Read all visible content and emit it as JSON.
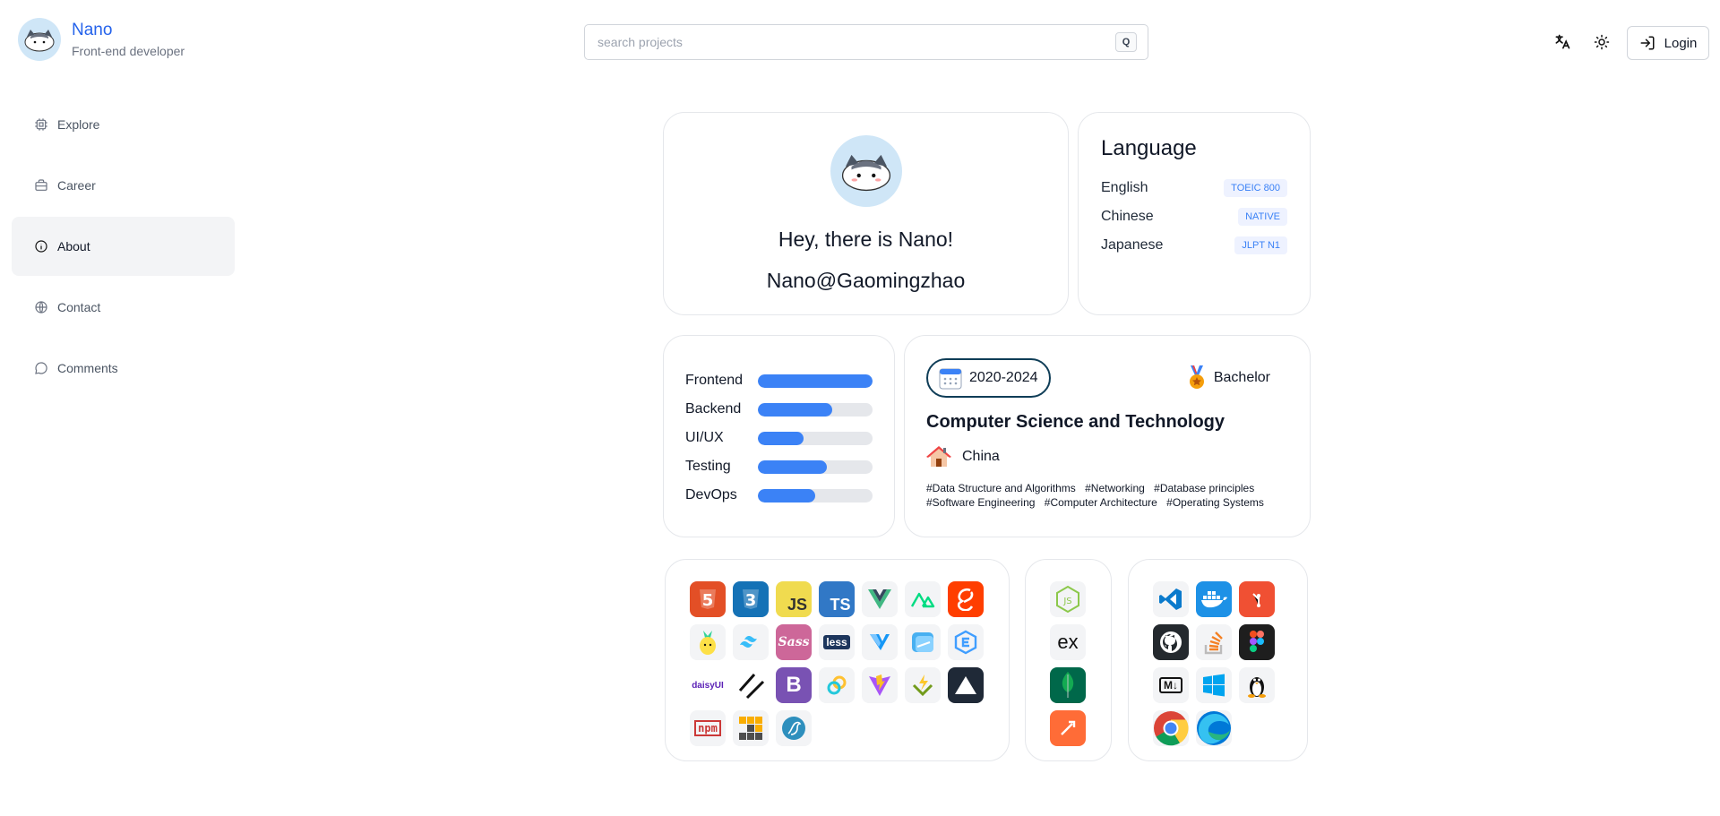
{
  "brand": {
    "name": "Nano",
    "subtitle": "Front-end developer"
  },
  "search": {
    "placeholder": "search projects",
    "key": "Q"
  },
  "header": {
    "login_label": "Login"
  },
  "nav": [
    {
      "label": "Explore",
      "icon": "cpu-icon",
      "active": false
    },
    {
      "label": "Career",
      "icon": "briefcase-icon",
      "active": false
    },
    {
      "label": "About",
      "icon": "info-icon",
      "active": true
    },
    {
      "label": "Contact",
      "icon": "globe-icon",
      "active": false
    },
    {
      "label": "Comments",
      "icon": "chat-icon",
      "active": false
    }
  ],
  "profile": {
    "greeting": "Hey, there is Nano!",
    "handle": "Nano@Gaomingzhao"
  },
  "language": {
    "title": "Language",
    "items": [
      {
        "name": "English",
        "level": "TOEIC 800"
      },
      {
        "name": "Chinese",
        "level": "NATIVE"
      },
      {
        "name": "Japanese",
        "level": "JLPT N1"
      }
    ]
  },
  "skills": [
    {
      "name": "Frontend",
      "level": 1.0
    },
    {
      "name": "Backend",
      "level": 0.65
    },
    {
      "name": "UI/UX",
      "level": 0.4
    },
    {
      "name": "Testing",
      "level": 0.6
    },
    {
      "name": "DevOps",
      "level": 0.5
    }
  ],
  "education": {
    "years": "2020-2024",
    "degree": "Bachelor",
    "major": "Computer Science and Technology",
    "location": "China",
    "tags": [
      "#Data Structure and Algorithms",
      "#Networking",
      "#Database principles",
      "#Software Engineering",
      "#Computer Architecture",
      "#Operating Systems"
    ]
  },
  "tech": {
    "frontend": [
      "html5-icon",
      "css3-icon",
      "javascript-icon",
      "typescript-icon",
      "vue-icon",
      "nuxt-icon",
      "svelte-icon",
      "pinia-icon",
      "tailwind-icon",
      "sass-icon",
      "less-icon",
      "vuetify-icon",
      "windicss-icon",
      "element-plus-icon",
      "daisyui-icon",
      "shadcn-icon",
      "bootstrap-icon",
      "tauri-icon",
      "vite-icon",
      "vitest-icon",
      "vercel-icon",
      "npm-icon",
      "pnpm-icon",
      "mariadb-icon"
    ],
    "backend": [
      "nodejs-icon",
      "express-icon",
      "mongodb-icon",
      "postman-icon"
    ],
    "tools": [
      "vscode-icon",
      "docker-icon",
      "git-icon",
      "github-icon",
      "stackoverflow-icon",
      "figma-icon",
      "markdown-icon",
      "windows-icon",
      "linux-icon",
      "chrome-icon",
      "edge-icon"
    ]
  },
  "tile_labels": {
    "js": "JS",
    "ts": "TS",
    "less": "less",
    "daisy": "daisyUI",
    "npm": "npm",
    "md": "M↓",
    "ex": "ex"
  },
  "colors": {
    "accent": "#2563eb",
    "bar": "#3b82f6",
    "bar_track": "#e5e7eb"
  }
}
